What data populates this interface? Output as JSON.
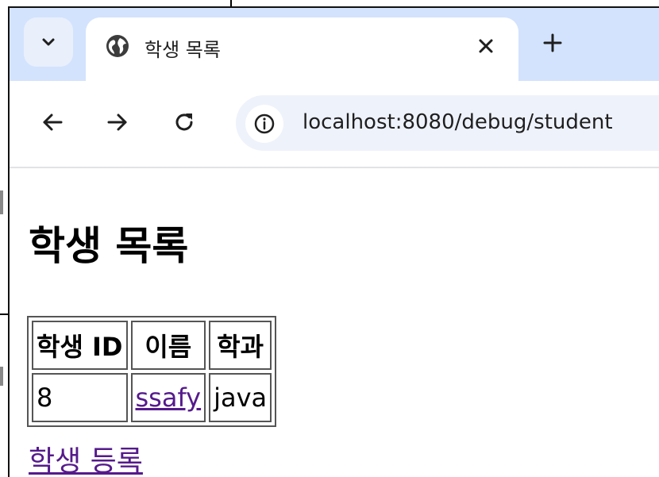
{
  "browser": {
    "tab": {
      "title": "학생 목록",
      "close_label": "✕"
    },
    "new_tab_label": "+",
    "address_bar": {
      "url": "localhost:8080/debug/student"
    }
  },
  "page": {
    "heading": "학생 목록",
    "table": {
      "headers": [
        "학생 ID",
        "이름",
        "학과"
      ],
      "rows": [
        {
          "id": "8",
          "name": "ssafy",
          "major": "java"
        }
      ]
    },
    "register_link": "학생 등록"
  },
  "icons": {
    "tab_search": "chevron-down-icon",
    "favicon": "globe-icon",
    "back": "arrow-left-icon",
    "forward": "arrow-right-icon",
    "reload": "reload-icon",
    "site_info": "info-icon"
  },
  "colors": {
    "tabstrip": "#d3e3fd",
    "omnibox": "#eef2fb",
    "visited_link": "#551a8b"
  }
}
